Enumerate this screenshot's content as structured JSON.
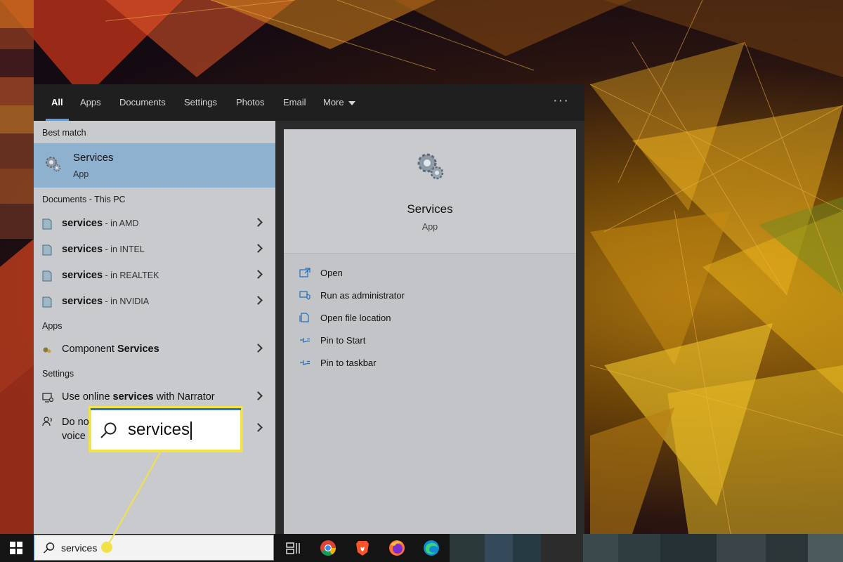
{
  "tabs": [
    {
      "label": "All",
      "active": true
    },
    {
      "label": "Apps"
    },
    {
      "label": "Documents"
    },
    {
      "label": "Settings"
    },
    {
      "label": "Photos"
    },
    {
      "label": "Email"
    },
    {
      "label": "More"
    }
  ],
  "ellipsis": "···",
  "best_match": {
    "header": "Best match",
    "title": "Services",
    "subtitle": "App"
  },
  "documents": {
    "header": "Documents - This PC",
    "items": [
      {
        "name": "services",
        "location": " - in AMD"
      },
      {
        "name": "services",
        "location": " - in INTEL"
      },
      {
        "name": "services",
        "location": " - in REALTEK"
      },
      {
        "name": "services",
        "location": " - in NVIDIA"
      }
    ]
  },
  "apps": {
    "header": "Apps",
    "item_prefix": "Component ",
    "item_bold": "Services"
  },
  "settings": {
    "header": "Settings",
    "item1_prefix": "Use online ",
    "item1_bold": "services",
    "item1_suffix": " with Narrator",
    "item2_line1": "Do no",
    "item2_line2": "voice"
  },
  "preview": {
    "title": "Services",
    "subtitle": "App"
  },
  "actions": [
    {
      "label": "Open",
      "icon": "open-icon"
    },
    {
      "label": "Run as administrator",
      "icon": "shield-icon"
    },
    {
      "label": "Open file location",
      "icon": "file-location-icon"
    },
    {
      "label": "Pin to Start",
      "icon": "pin-icon"
    },
    {
      "label": "Pin to taskbar",
      "icon": "pin-icon"
    }
  ],
  "taskbar": {
    "search_value": "services"
  },
  "callout": {
    "text": "services"
  },
  "colors": {
    "accent": "#4ea1f3",
    "highlight": "#8fb1d0",
    "callout_border": "#f1e24a"
  }
}
